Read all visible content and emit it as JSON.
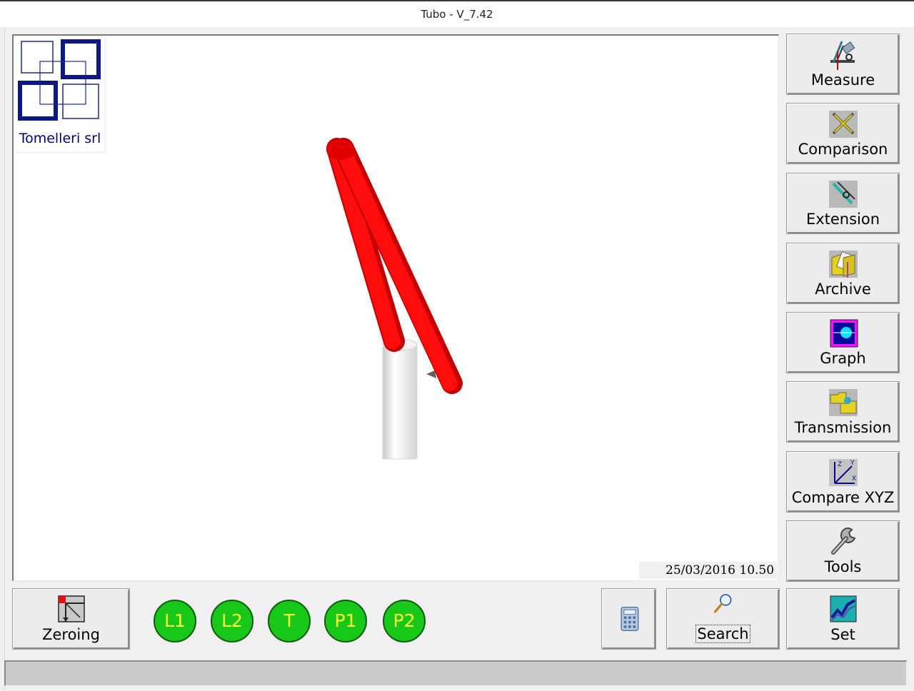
{
  "window": {
    "title": "Tubo - V_7.42"
  },
  "logo": {
    "company": "Tomelleri srl"
  },
  "viewport": {
    "datetime": "25/03/2016  10.50",
    "tube_color": "#ff0000",
    "clamp_color": "#e8e8e8"
  },
  "sidebar": {
    "buttons": [
      {
        "label": "Measure",
        "icon": "measure-icon"
      },
      {
        "label": "Comparison",
        "icon": "comparison-icon"
      },
      {
        "label": "Extension",
        "icon": "extension-icon"
      },
      {
        "label": "Archive",
        "icon": "archive-icon"
      },
      {
        "label": "Graph",
        "icon": "graph-icon"
      },
      {
        "label": "Transmission",
        "icon": "transmission-icon"
      },
      {
        "label": "Compare XYZ",
        "icon": "compare-xyz-icon"
      },
      {
        "label": "Tools",
        "icon": "wrench-icon"
      }
    ]
  },
  "bottom": {
    "zeroing_label": "Zeroing",
    "indicators": [
      "L1",
      "L2",
      "T",
      "P1",
      "P2"
    ],
    "indicator_color": "#18c818",
    "search_label": "Search",
    "set_label": "Set"
  },
  "status": {
    "text": ""
  }
}
